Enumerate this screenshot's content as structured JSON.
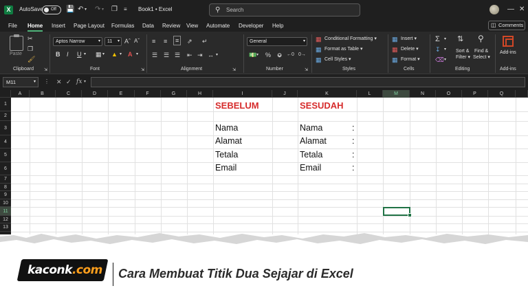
{
  "titlebar": {
    "autosave_label": "AutoSave",
    "autosave_state": "Off",
    "doc_title": "Book1 • Excel",
    "search_placeholder": "Search",
    "comments_label": "Comments"
  },
  "menu": {
    "tabs": [
      "File",
      "Home",
      "Insert",
      "Page Layout",
      "Formulas",
      "Data",
      "Review",
      "View",
      "Automate",
      "Developer",
      "Help"
    ],
    "active": "Home"
  },
  "ribbon": {
    "clipboard": {
      "label": "Clipboard",
      "paste": "Paste"
    },
    "font": {
      "label": "Font",
      "family": "Aptos Narrow",
      "size": "11"
    },
    "alignment": {
      "label": "Alignment"
    },
    "number": {
      "label": "Number",
      "format": "General"
    },
    "styles": {
      "label": "Styles",
      "conditional": "Conditional Formatting",
      "format_table": "Format as Table",
      "cell_styles": "Cell Styles"
    },
    "cells": {
      "label": "Cells",
      "insert": "Insert",
      "delete": "Delete",
      "format": "Format"
    },
    "editing": {
      "label": "Editing",
      "sort_1": "Sort &",
      "sort_2": "Filter",
      "find_1": "Find &",
      "find_2": "Select"
    },
    "addins": {
      "label": "Add-ins",
      "button": "Add-ins"
    }
  },
  "formula_bar": {
    "namebox": "M11",
    "fx": "fx",
    "value": ""
  },
  "grid": {
    "columns": [
      "A",
      "B",
      "C",
      "D",
      "E",
      "F",
      "G",
      "H",
      "I",
      "J",
      "K",
      "L",
      "M",
      "N",
      "O",
      "P",
      "Q"
    ],
    "rows": [
      "1",
      "2",
      "3",
      "4",
      "5",
      "6",
      "7",
      "8",
      "9",
      "10",
      "11",
      "12",
      "13"
    ],
    "selected_col": "M",
    "selected_row": "11",
    "cells": {
      "I1": "SEBELUM",
      "K1": "SESUDAH",
      "I3": "Nama",
      "I4": "Alamat",
      "I5": "Tetala",
      "I6": "Email",
      "K3": "Nama",
      "K4": "Alamat",
      "K5": "Tetala",
      "K6": "Email",
      "colon": ":"
    }
  },
  "banner": {
    "logo_main": "kaconk",
    "logo_suffix": ".com",
    "title": "Cara Membuat Titik Dua Sejajar di Excel"
  },
  "colors": {
    "accent_green": "#217346",
    "header_red": "#d62b2b",
    "logo_dot": "#ff9f1c"
  }
}
